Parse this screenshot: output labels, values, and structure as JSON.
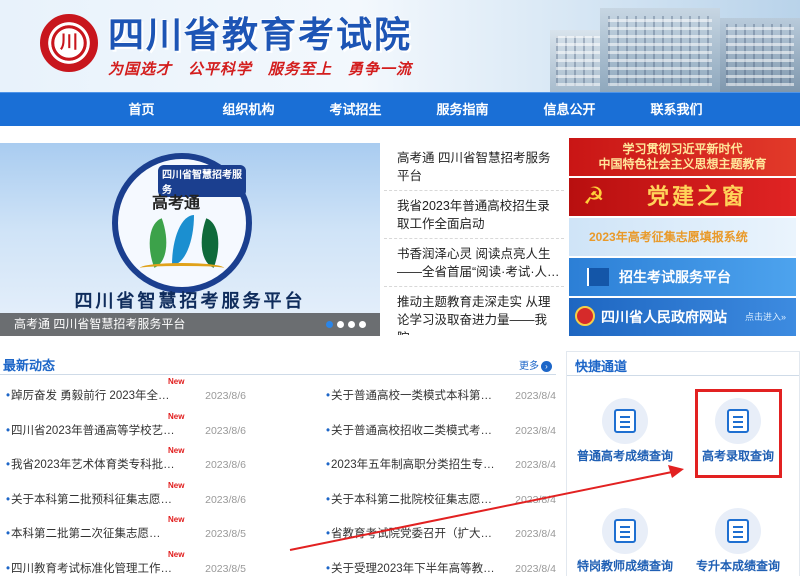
{
  "header": {
    "site_title": "四川省教育考试院",
    "motto": "为国选才　公平科学　服务至上　勇争一流"
  },
  "nav": {
    "items": [
      "首页",
      "组织机构",
      "考试招生",
      "服务指南",
      "信息公开",
      "联系我们"
    ]
  },
  "carousel": {
    "ring_text": "四川省智慧招考服务",
    "emblem_text": "高考通",
    "big_caption": "四川省智慧招考服务平台",
    "caption": "高考通 四川省智慧招考服务平台",
    "slides": 4,
    "active_index": 0
  },
  "headlines": [
    "高考通 四川省智慧招考服务平台",
    "我省2023年普通高校招生录取工作全面启动",
    "书香润泽心灵 阅读点亮人生——全省首届“阅读·考试·人…",
    "推动主题教育走深走实 从理论学习汲取奋进力量——我院…"
  ],
  "right_banners": {
    "b1_line1": "学习贯彻习近平新时代",
    "b1_line2": "中国特色社会主义思想主题教育",
    "b2_icon": "☭",
    "b2_text": "党建之窗",
    "b3_text": "2023年高考征集志愿填报系统",
    "b4_text": "招生考试服务平台",
    "b5_text": "四川省人民政府网站",
    "b5_enter": "点击进入»"
  },
  "news": {
    "title": "最新动态",
    "more": "更多",
    "new_tag": "New",
    "left": [
      {
        "title": "踔厉奋发 勇毅前行 2023年全…",
        "date": "2023/8/6",
        "new": true
      },
      {
        "title": "四川省2023年普通高等学校艺…",
        "date": "2023/8/6",
        "new": true
      },
      {
        "title": "我省2023年艺术体育类专科批…",
        "date": "2023/8/6",
        "new": true
      },
      {
        "title": "关于本科第二批预科征集志愿…",
        "date": "2023/8/6",
        "new": true
      },
      {
        "title": "本科第二批第二次征集志愿…",
        "date": "2023/8/5",
        "new": true
      },
      {
        "title": "四川教育考试标准化管理工作…",
        "date": "2023/8/5",
        "new": true
      }
    ],
    "right": [
      {
        "title": "关于普通高校一类模式本科第…",
        "date": "2023/8/4"
      },
      {
        "title": "关于普通高校招收二类模式考…",
        "date": "2023/8/4"
      },
      {
        "title": "2023年五年制高职分类招生专…",
        "date": "2023/8/4"
      },
      {
        "title": "关于本科第二批院校征集志愿…",
        "date": "2023/8/4"
      },
      {
        "title": "省教育考试院党委召开（扩大…",
        "date": "2023/8/4"
      },
      {
        "title": "关于受理2023年下半年高等教…",
        "date": "2023/8/4"
      }
    ]
  },
  "quick": {
    "title": "快捷通道",
    "items": [
      {
        "label": "普通高考成绩查询",
        "icon": "edit-icon"
      },
      {
        "label": "高考录取查询",
        "icon": "clipboard-check-icon"
      },
      {
        "label": "特岗教师成绩查询",
        "icon": "document-icon"
      },
      {
        "label": "专升本成绩查询",
        "icon": "edit-icon"
      }
    ]
  },
  "colors": {
    "nav_bg": "#1a6fd6",
    "title_blue": "#1d55b5",
    "motto_red": "#d31d1d",
    "highlight_red": "#e22121"
  }
}
